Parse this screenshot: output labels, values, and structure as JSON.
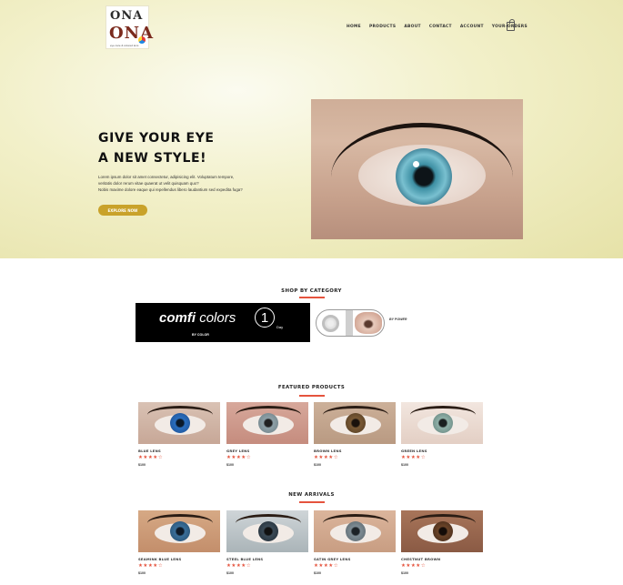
{
  "header": {
    "logo": {
      "glyph": "ONA",
      "brand": "ONA",
      "tagline": "eye care & colored lens"
    },
    "nav": [
      "HOME",
      "PRODUCTS",
      "ABOUT",
      "CONTACT",
      "ACCOUNT",
      "YOUR-ORDERS"
    ],
    "cart_icon": "shopping-bag-icon"
  },
  "hero": {
    "title_line1": "GIVE YOUR EYE",
    "title_line2": "A NEW STYLE!",
    "text_line1": "Lorem ipsum dolor sit amet consectetur, adipisicing elit. Voluptatum tempore,",
    "text_line2": "veritatis dolor rerum vitae quaerat ut velit quisquam quo?",
    "text_line3": "Nobis maxime dolore eaque qui repellendus libero laudantium sed expedita fuga?",
    "button": "EXPLORE NOW"
  },
  "category": {
    "title": "SHOP BY CATEGORY",
    "comfi": {
      "name_a": "comfi",
      "name_b": "colors",
      "number": "1",
      "day": "Day",
      "by": "BY COLOR"
    },
    "power_label": "BY POWER"
  },
  "featured": {
    "title": "FEATURED PRODUCTS",
    "products": [
      {
        "name": "BLUE LENS",
        "stars": "★★★★☆",
        "price": "$100"
      },
      {
        "name": "GREY LENS",
        "stars": "★★★★☆",
        "price": "$100"
      },
      {
        "name": "BROWN LENS",
        "stars": "★★★★☆",
        "price": "$100"
      },
      {
        "name": "GREEN LENS",
        "stars": "★★★★☆",
        "price": "$100"
      }
    ]
  },
  "arrivals": {
    "title": "NEW ARRIVALS",
    "products": [
      {
        "name": "SEAMINK BLUE LENS",
        "stars": "★★★★☆",
        "price": "$100"
      },
      {
        "name": "STEEL BLUE LENS",
        "stars": "★★★★☆",
        "price": "$100"
      },
      {
        "name": "SATIN GREY LENS",
        "stars": "★★★★☆",
        "price": "$100"
      },
      {
        "name": "CHESTNUT BROWN",
        "stars": "★★★★☆",
        "price": "$100"
      }
    ]
  },
  "colors": {
    "accent": "#e5533d",
    "button": "#c9a22a",
    "hero_bg": "#f2f0c9"
  }
}
